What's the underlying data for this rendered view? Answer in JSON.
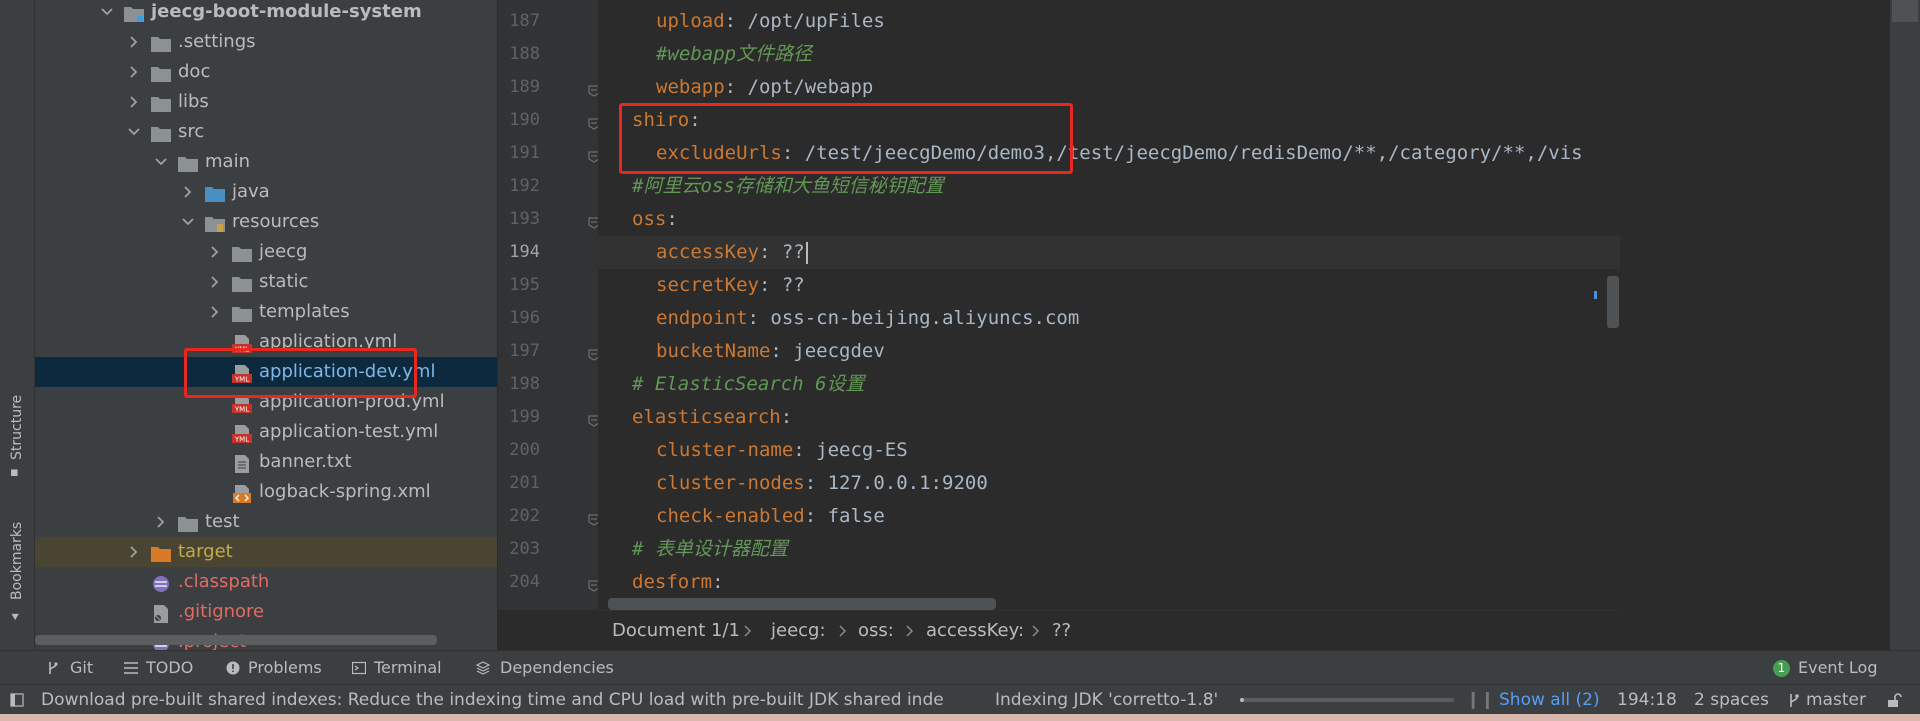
{
  "sidebar": {
    "structure_label": "Structure",
    "bookmarks_label": "Bookmarks"
  },
  "project_tree": {
    "items": [
      {
        "label": "jeecg-boot-module-system",
        "icon": "module-folder-icon"
      },
      {
        "label": ".settings",
        "icon": "folder-icon"
      },
      {
        "label": "doc",
        "icon": "folder-icon"
      },
      {
        "label": "libs",
        "icon": "folder-icon"
      },
      {
        "label": "src",
        "icon": "folder-icon"
      },
      {
        "label": "main",
        "icon": "folder-icon"
      },
      {
        "label": "java",
        "icon": "source-folder-icon"
      },
      {
        "label": "resources",
        "icon": "resources-folder-icon"
      },
      {
        "label": "jeecg",
        "icon": "folder-icon"
      },
      {
        "label": "static",
        "icon": "folder-icon"
      },
      {
        "label": "templates",
        "icon": "folder-icon"
      },
      {
        "label": "application.yml",
        "icon": "yml-file-icon"
      },
      {
        "label": "application-dev.yml",
        "icon": "yml-file-icon"
      },
      {
        "label": "application-prod.yml",
        "icon": "yml-file-icon"
      },
      {
        "label": "application-test.yml",
        "icon": "yml-file-icon"
      },
      {
        "label": "banner.txt",
        "icon": "text-file-icon"
      },
      {
        "label": "logback-spring.xml",
        "icon": "xml-file-icon"
      },
      {
        "label": "test",
        "icon": "folder-icon"
      },
      {
        "label": "target",
        "icon": "excluded-folder-icon"
      },
      {
        "label": ".classpath",
        "icon": "classpath-file-icon"
      },
      {
        "label": ".gitignore",
        "icon": "gitignore-file-icon"
      },
      {
        "label": ".project",
        "icon": "project-file-icon"
      }
    ]
  },
  "editor": {
    "current_line": 194,
    "lines": [
      {
        "num": 187,
        "key": "upload",
        "val": " /opt/upFiles"
      },
      {
        "num": 188,
        "comment": "#webapp文件路径"
      },
      {
        "num": 189,
        "key": "webapp",
        "val": " /opt/webapp"
      },
      {
        "num": 190,
        "key": "shiro",
        "val": ""
      },
      {
        "num": 191,
        "key": "excludeUrls",
        "val": " /test/jeecgDemo/demo3,/test/jeecgDemo/redisDemo/**,/category/**,/vis"
      },
      {
        "num": 192,
        "comment": "#阿里云oss存储和大鱼短信秘钥配置"
      },
      {
        "num": 193,
        "key": "oss",
        "val": ""
      },
      {
        "num": 194,
        "key": "accessKey",
        "val": " ??"
      },
      {
        "num": 195,
        "key": "secretKey",
        "val": " ??"
      },
      {
        "num": 196,
        "key": "endpoint",
        "val": " oss-cn-beijing.aliyuncs.com"
      },
      {
        "num": 197,
        "key": "bucketName",
        "val": " jeecgdev"
      },
      {
        "num": 198,
        "comment": "# ElasticSearch 6设置"
      },
      {
        "num": 199,
        "key": "elasticsearch",
        "val": ""
      },
      {
        "num": 200,
        "key": "cluster-name",
        "val": " jeecg-ES"
      },
      {
        "num": 201,
        "key": "cluster-nodes",
        "val": " 127.0.0.1:9200"
      },
      {
        "num": 202,
        "key": "check-enabled",
        "val": " false"
      },
      {
        "num": 203,
        "comment": "# 表单设计器配置"
      },
      {
        "num": 204,
        "key": "desform",
        "val": ""
      }
    ]
  },
  "breadcrumb": {
    "document": "Document 1/1",
    "path": [
      "jeecg:",
      "oss:",
      "accessKey:",
      "??"
    ]
  },
  "tool_windows": {
    "git": "Git",
    "todo": "TODO",
    "problems": "Problems",
    "terminal": "Terminal",
    "dependencies": "Dependencies",
    "event_log": "Event Log",
    "event_count": "1"
  },
  "status_bar": {
    "message": "Download pre-built shared indexes: Reduce the indexing time and CPU load with pre-built JDK shared inde",
    "indexing": "Indexing JDK 'corretto-1.8'",
    "progress": 0.02,
    "show_all": "Show all (2)",
    "position": "194:18",
    "indent": "2 spaces",
    "branch": "master"
  },
  "colors": {
    "highlight_box": "#e8271f",
    "keyword": "#cc7832",
    "comment": "#629755",
    "value": "#a9b7c6",
    "selected_row": "#0d293e",
    "link": "#589df6"
  }
}
